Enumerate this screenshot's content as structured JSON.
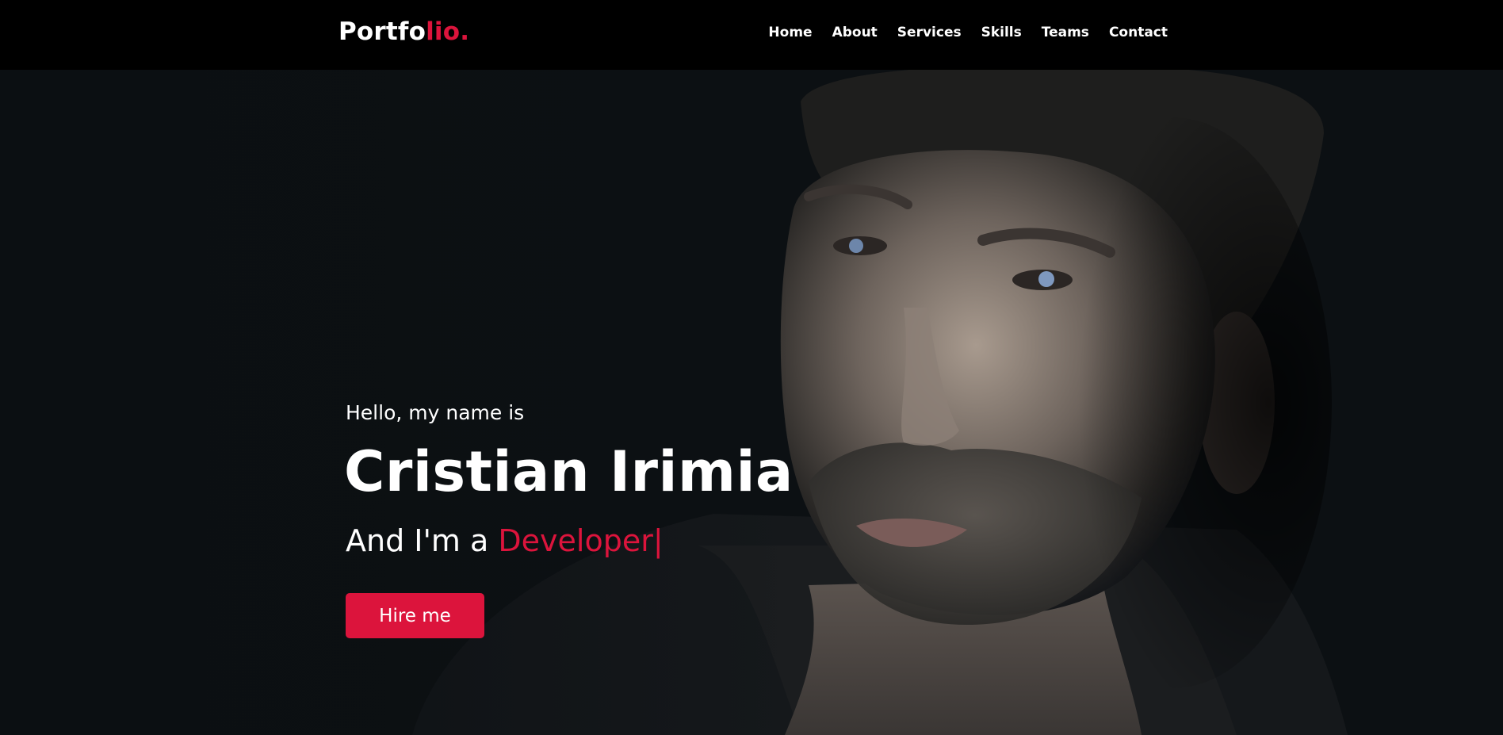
{
  "brand": {
    "logo_main": "Portfo",
    "logo_accent": "lio."
  },
  "nav": {
    "items": [
      {
        "label": "Home"
      },
      {
        "label": "About"
      },
      {
        "label": "Services"
      },
      {
        "label": "Skills"
      },
      {
        "label": "Teams"
      },
      {
        "label": "Contact"
      }
    ]
  },
  "hero": {
    "greeting": "Hello, my name is",
    "name": "Cristian Irimia",
    "role_prefix": "And I'm a ",
    "role_typed": "Developer",
    "role_cursor": "|",
    "cta_label": "Hire me"
  },
  "colors": {
    "accent": "#dc143c",
    "nav_bg": "#000000",
    "hero_bg": "#0b0f12"
  }
}
